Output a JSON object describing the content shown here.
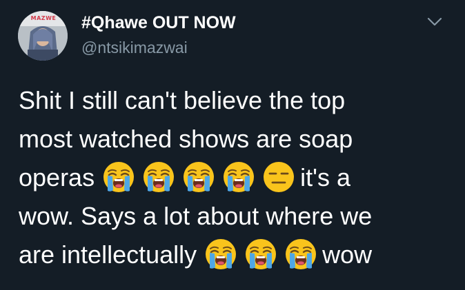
{
  "tweet": {
    "display_name": "#Qhawe OUT NOW",
    "handle": "@ntsikimazwai",
    "avatar_logo_text": "MAZWE",
    "lines": [
      {
        "text_before": "Shit I still can't believe the top",
        "emojis": [],
        "text_after": ""
      },
      {
        "text_before": "most watched shows are soap",
        "emojis": [],
        "text_after": ""
      },
      {
        "text_before": "operas ",
        "emojis": [
          "crying",
          "crying",
          "crying",
          "crying",
          "expressionless"
        ],
        "text_after": "it's a"
      },
      {
        "text_before": "wow. Says a lot about where we",
        "emojis": [],
        "text_after": ""
      },
      {
        "text_before": "are intellectually ",
        "emojis": [
          "crying",
          "crying",
          "crying"
        ],
        "text_after": "wow"
      }
    ]
  },
  "icons": {
    "menu": "chevron-down-icon",
    "emoji_crying": "loudly-crying-face-icon",
    "emoji_expressionless": "expressionless-face-icon"
  },
  "colors": {
    "background": "#141d26",
    "text": "#ffffff",
    "secondary_text": "#8899a6",
    "emoji_face": "#f9c41c",
    "tears": "#4fa7e6"
  }
}
